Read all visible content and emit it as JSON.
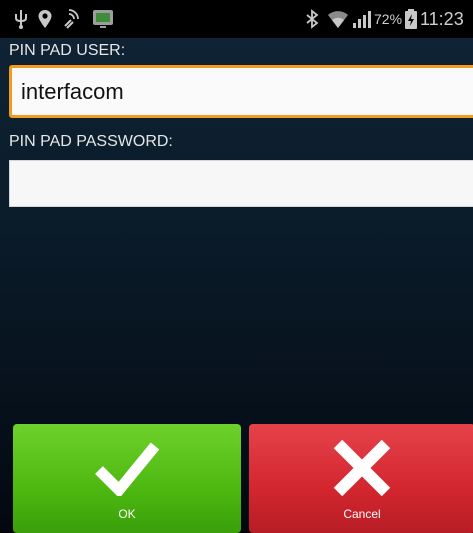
{
  "status_bar": {
    "left_icons": [
      "usb-icon",
      "location-pin-icon",
      "nfc-icon",
      "screen-mirror-icon"
    ],
    "right_icons": [
      "bluetooth-icon",
      "wifi-icon",
      "signal-icon",
      "battery-charging-icon"
    ],
    "battery_percent": "72%",
    "time": "11:23"
  },
  "form": {
    "user_label": "PIN PAD USER:",
    "user_value": "interfacom",
    "password_label": "PIN PAD PASSWORD:",
    "password_value": ""
  },
  "actions": {
    "ok_label": "OK",
    "cancel_label": "Cancel"
  },
  "colors": {
    "accent_focus": "#f29a22",
    "ok_green": "#4db810",
    "cancel_red": "#d3262f"
  }
}
